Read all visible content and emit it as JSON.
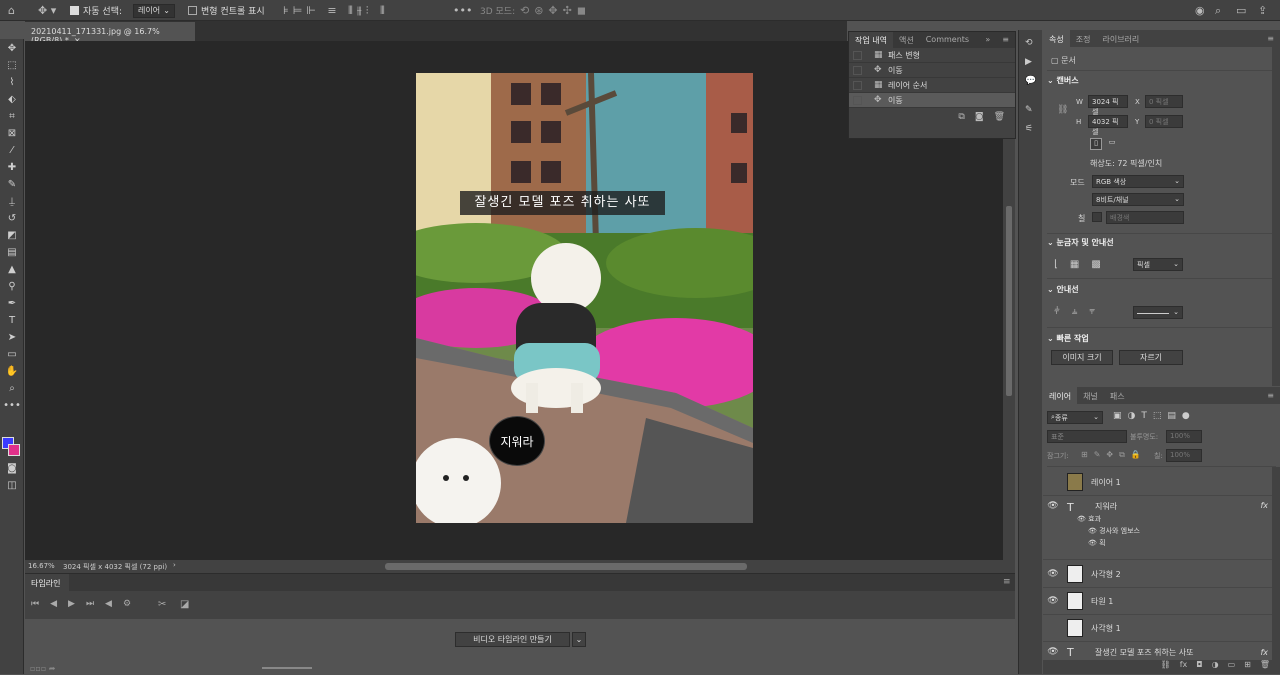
{
  "options_bar": {
    "auto_select_label": "자동 선택:",
    "auto_select_value": "레이어",
    "transform_controls_label": "변형 컨트롤 표시",
    "mode_3d_label": "3D 모드:"
  },
  "document": {
    "tab_title": "20210411_171331.jpg @ 16.7% (RGB/8) *",
    "zoom": "16.67%",
    "dimensions": "3024 픽셀 x 4032 픽셀 (72 ppi)",
    "caption_text": "잘생긴 모델 포즈 취하는 사또",
    "bubble_text": "지워라"
  },
  "history": {
    "tabs": [
      "작업 내역",
      "액션",
      "Comments"
    ],
    "items": [
      "패스 변형",
      "이동",
      "레이어 순서",
      "이동"
    ]
  },
  "properties": {
    "tabs": [
      "속성",
      "조정",
      "라이브러리"
    ],
    "doc_label": "문서",
    "canvas_header": "캔버스",
    "w_label": "W",
    "w_value": "3024 픽셀",
    "x_label": "X",
    "x_value": "0 픽셀",
    "h_label": "H",
    "h_value": "4032 픽셀",
    "y_label": "Y",
    "y_value": "0 픽셀",
    "resolution": "해상도: 72 픽셀/인치",
    "mode_label": "모드",
    "mode_value": "RGB 색상",
    "depth_value": "8비트/채널",
    "fill_label": "칠",
    "fill_value": "배경색",
    "rulers_header": "눈금자 및 안내선",
    "rulers_unit": "픽셀",
    "guides_header": "안내선",
    "quick_header": "빠른 작업",
    "image_size_btn": "이미지 크기",
    "crop_btn": "자르기"
  },
  "layers": {
    "tabs": [
      "레이어",
      "채널",
      "패스"
    ],
    "filter_value": "종류",
    "blend_value": "표준",
    "opacity_label": "불투명도:",
    "opacity_value": "100%",
    "lock_label": "잠그기:",
    "fill_label": "칠:",
    "fill_value": "100%",
    "rows": [
      {
        "name": "레이어 1",
        "type": "image",
        "visible": false
      },
      {
        "name": "지워라",
        "type": "text",
        "visible": true,
        "fx": "fx"
      },
      {
        "name": "효과",
        "type": "effect",
        "visible": true
      },
      {
        "name": "경사와 엠보스",
        "type": "effect",
        "visible": true
      },
      {
        "name": "획",
        "type": "effect",
        "visible": true
      },
      {
        "name": "사각형 2",
        "type": "shape",
        "visible": true
      },
      {
        "name": "타원 1",
        "type": "shape",
        "visible": true
      },
      {
        "name": "사각형 1",
        "type": "shape",
        "visible": false
      },
      {
        "name": "잘생긴 모델 포즈 취하는 사또",
        "type": "text",
        "visible": true,
        "fx": "fx"
      }
    ]
  },
  "timeline": {
    "title": "타임라인",
    "create_btn": "비디오 타임라인 만들기"
  },
  "colors": {
    "foreground": "#3a3aff",
    "background": "#e0308a"
  }
}
